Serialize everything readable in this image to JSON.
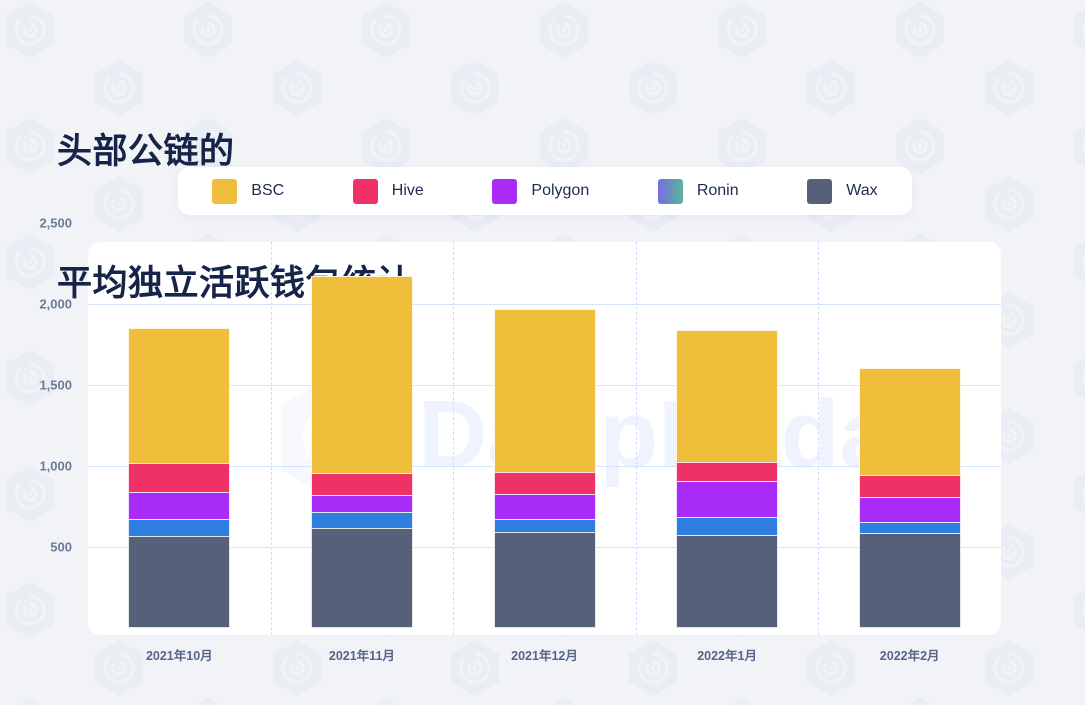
{
  "title": {
    "line1": "头部公链的",
    "line2": "平均独立活跃钱包统计"
  },
  "watermark": {
    "brand": "DappRadar",
    "logo_icon": "dappradar-hexagon-logo"
  },
  "colors": {
    "background": "#f2f3f7",
    "card": "#ffffff",
    "title": "#16244a",
    "gridline": "#d6e4fb",
    "vertical_separator": "#cfe0fa",
    "axis_text": "#6c7a99",
    "x_axis_text": "#57638a",
    "legend_text": "#1d2b50",
    "bsc": "#efbf3c",
    "hive": "#ee3268",
    "polygon": "#a92bf7",
    "ronin": "#2f7fe0",
    "ronin_gradient_start": "#7b6ce0",
    "ronin_gradient_end": "#55b89a",
    "wax": "#566078"
  },
  "legend": {
    "items": [
      {
        "label": "BSC",
        "color": "#efbf3c",
        "swatch_type": "solid",
        "icon": "legend-swatch-bsc"
      },
      {
        "label": "Hive",
        "color": "#ee3268",
        "swatch_type": "solid",
        "icon": "legend-swatch-hive"
      },
      {
        "label": "Polygon",
        "color": "#a92bf7",
        "swatch_type": "solid",
        "icon": "legend-swatch-polygon"
      },
      {
        "label": "Ronin",
        "color": "#7b6ce0",
        "swatch_type": "gradient",
        "icon": "legend-swatch-ronin"
      },
      {
        "label": "Wax",
        "color": "#566078",
        "swatch_type": "solid",
        "icon": "legend-swatch-wax"
      }
    ]
  },
  "chart_data": {
    "type": "bar",
    "stacked": true,
    "title": "头部公链的 平均独立活跃钱包统计",
    "xlabel": "",
    "ylabel": "",
    "categories": [
      "2021年10月",
      "2021年11月",
      "2021年12月",
      "2022年1月",
      "2022年2月"
    ],
    "ylim": [
      0,
      2500
    ],
    "yticks": [
      500,
      1000,
      1500,
      2000,
      2500
    ],
    "ytick_labels": [
      "500",
      "1,000",
      "1,500",
      "2,000",
      "2,500"
    ],
    "grid": true,
    "legend_position": "top",
    "series": [
      {
        "name": "Wax",
        "color": "#566078",
        "values": [
          570,
          617,
          593,
          574,
          586
        ]
      },
      {
        "name": "Ronin",
        "color": "#2f7fe0",
        "values": [
          105,
          99,
          80,
          111,
          68
        ]
      },
      {
        "name": "Polygon",
        "color": "#a92bf7",
        "values": [
          165,
          105,
          154,
          222,
          154
        ]
      },
      {
        "name": "Hive",
        "color": "#ee3268",
        "values": [
          180,
          136,
          136,
          117,
          136
        ]
      },
      {
        "name": "BSC",
        "color": "#efbf3c",
        "values": [
          835,
          1216,
          1006,
          815,
          660
        ]
      }
    ],
    "totals": [
      1855,
      2173,
      1969,
      1839,
      1604
    ]
  }
}
